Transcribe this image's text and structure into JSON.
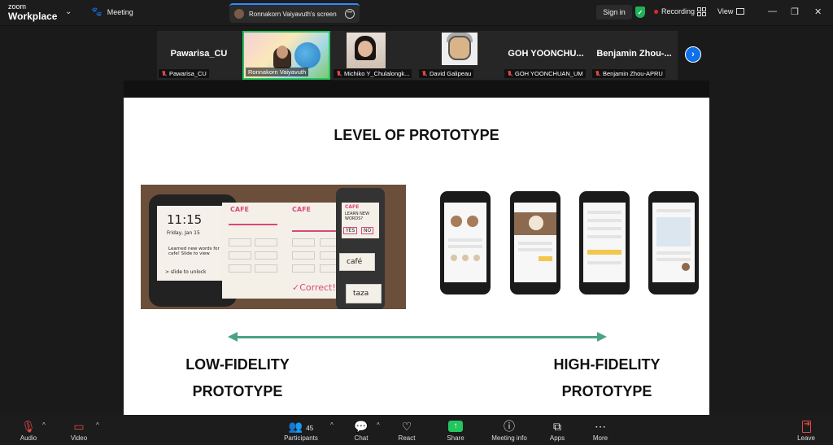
{
  "app": {
    "logo_line1": "zoom",
    "logo_line2": "Workplace",
    "meeting_label": "Meeting"
  },
  "screen_tab": {
    "title": "Ronnakorn Vaiyavuth's screen"
  },
  "top_right": {
    "signin": "Sign in",
    "recording": "Recording",
    "view": "View"
  },
  "colors": {
    "accent": "#0e71eb",
    "share_green": "#22c55e",
    "recording_red": "#e02828",
    "arrow_green": "#4aa384"
  },
  "participants": [
    {
      "display": "Pawarisa_CU",
      "label": "Pawarisa_CU",
      "video": false
    },
    {
      "display": "",
      "label": "Ronnakorn Vaiyavuth",
      "video": true,
      "active": true
    },
    {
      "display": "",
      "label": "Michiko Y_Chulalongk...",
      "video": true
    },
    {
      "display": "",
      "label": "David Galipeau",
      "video": true
    },
    {
      "display": "GOH YOONCHU...",
      "label": "GOH YOONCHUAN_UM",
      "video": false
    },
    {
      "display": "Benjamin Zhou-...",
      "label": "Benjamin Zhou-APRU",
      "video": false
    }
  ],
  "slide": {
    "title": "LEVEL OF PROTOTYPE",
    "low_label_1": "LOW-FIDELITY",
    "low_label_2": "PROTOTYPE",
    "high_label_1": "HIGH-FIDELITY",
    "high_label_2": "PROTOTYPE",
    "paper": {
      "time": "11:15",
      "date": "Friday, Jan 15",
      "learned": "Learned new words for cafe! Slide to view",
      "unlock": "> slide to unlock",
      "cafe": "CAFE",
      "learn_new": "LEARN NEW WORDS?",
      "yes": "YES",
      "no": "NO",
      "cafe_word": "café",
      "taza": "taza",
      "correct": "✓Correct!"
    }
  },
  "toolbar": {
    "audio": "Audio",
    "video": "Video",
    "participants": "Participants",
    "participants_count": "45",
    "chat": "Chat",
    "react": "React",
    "share": "Share",
    "meeting_info": "Meeting info",
    "apps": "Apps",
    "more": "More",
    "leave": "Leave"
  }
}
